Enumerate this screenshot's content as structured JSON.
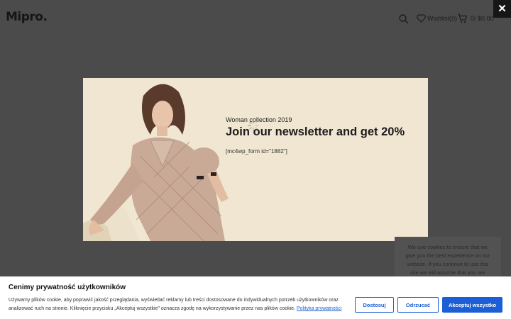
{
  "header": {
    "logo_text": "Mipro",
    "logo_dot": ".",
    "wishlist_label": "Wishlist(0)",
    "cart_label": "0/ $0.00"
  },
  "popup": {
    "close_label": "✕",
    "subtitle": "Woman collection 2019",
    "title": "Join our newsletter and get 20%",
    "form_shortcode": "[mc4wp_form id=\"1882\"]"
  },
  "cookie_note": {
    "text": "We use cookies to ensure that we give you the best experience on our website. If you continue to use this site we will assume that you are"
  },
  "consent": {
    "title": "Cenimy prywatność użytkowników",
    "text": "Używamy plików cookie, aby poprawić jakość przeglądania, wyświetlać reklamy lub treści dostosowane do indywidualnych potrzeb użytkowników oraz analizować ruch na stronie. Kliknięcie przycisku „Akceptuj wszystkie\" oznacza zgodę na wykorzystywanie przez nas plików cookie.",
    "policy_link": "Polityka prywatności",
    "customize_label": "Dostosuj",
    "reject_label": "Odrzucać",
    "accept_label": "Akceptuj wszystko"
  },
  "colors": {
    "overlay": "#4b4b4b",
    "popup_bg": "#f1e6d1",
    "accent": "#1a5fd6"
  }
}
